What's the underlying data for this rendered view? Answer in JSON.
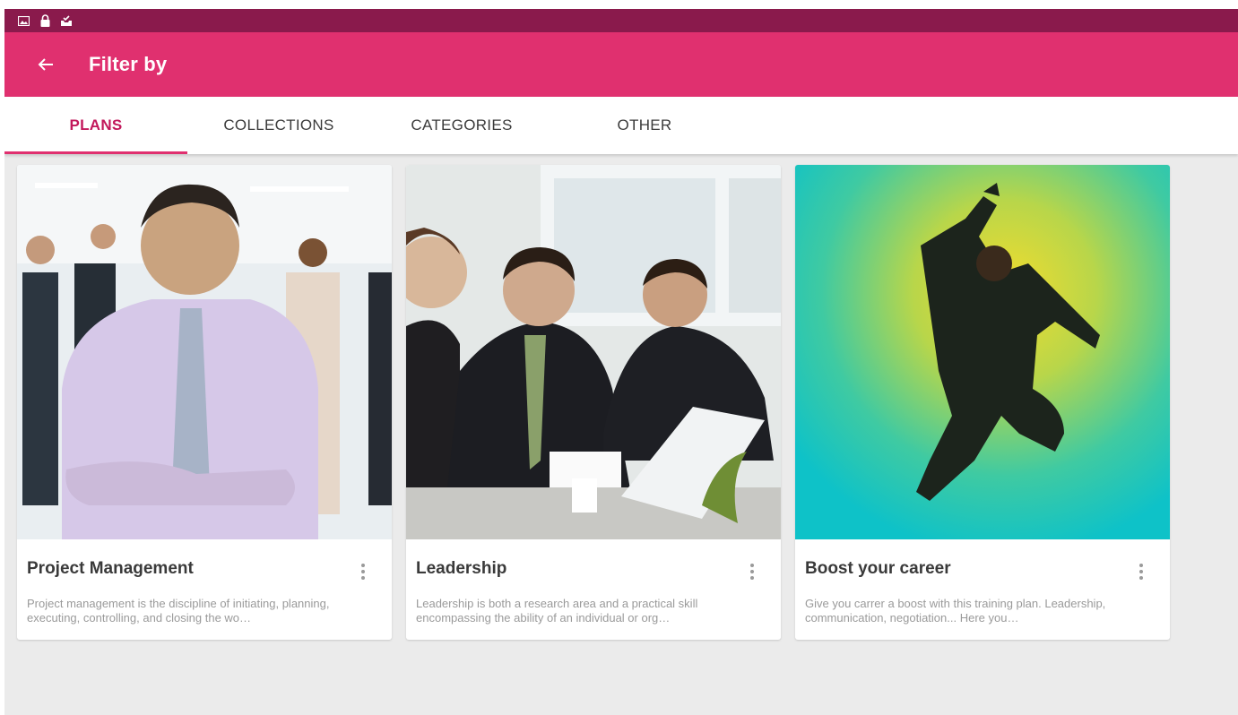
{
  "appbar": {
    "title": "Filter by"
  },
  "tabs": [
    {
      "label": "PLANS",
      "active": true
    },
    {
      "label": "COLLECTIONS",
      "active": false
    },
    {
      "label": "CATEGORIES",
      "active": false
    },
    {
      "label": "OTHER",
      "active": false
    }
  ],
  "cards": [
    {
      "title": "Project Management",
      "description": "Project management is the discipline of initiating, planning, executing, controlling, and closing the wo…"
    },
    {
      "title": "Leadership",
      "description": "Leadership is both a research area and a practical skill encompassing the ability of an individual or org…"
    },
    {
      "title": "Boost your career",
      "description": "Give you carrer a boost with this training plan. Leadership, communication, negotiation... Here you…"
    }
  ],
  "colors": {
    "status_bar": "#8a1a4c",
    "app_bar": "#e0306f",
    "tab_active": "#c2185b",
    "background": "#ebebeb"
  },
  "icons": {
    "status": [
      "image-icon",
      "lock-icon",
      "inbox-check-icon"
    ],
    "back": "arrow-left-icon",
    "card_menu": "more-vertical-icon"
  }
}
